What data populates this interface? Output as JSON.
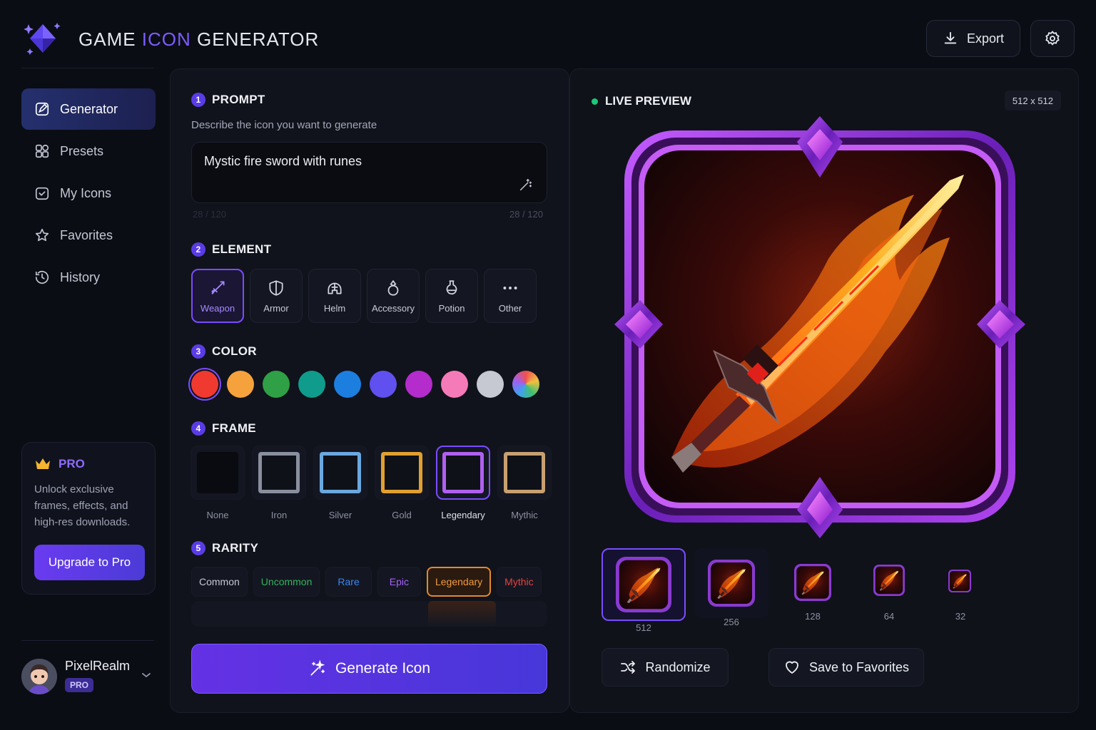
{
  "app": {
    "title_pre": "GAME ",
    "title_accent": "ICON",
    "title_post": " GENERATOR"
  },
  "header": {
    "export_label": "Export",
    "export_icon": "download-icon",
    "settings_icon": "gear-icon"
  },
  "sidebar": {
    "items": [
      {
        "label": "Generator",
        "icon": "edit-square-icon",
        "active": true
      },
      {
        "label": "Presets",
        "icon": "grid-shapes-icon",
        "active": false
      },
      {
        "label": "My Icons",
        "icon": "folder-check-icon",
        "active": false
      },
      {
        "label": "Favorites",
        "icon": "star-icon",
        "active": false
      },
      {
        "label": "History",
        "icon": "history-icon",
        "active": false
      }
    ],
    "pro": {
      "title": "PRO",
      "text": "Unlock exclusive frames, effects, and high-res downloads.",
      "button": "Upgrade to Pro"
    },
    "user": {
      "name": "PixelRealm",
      "badge": "PRO"
    }
  },
  "prompt": {
    "num": "1",
    "title": "PROMPT",
    "hint": "Describe the icon you want to generate",
    "value": "Mystic fire sword with runes",
    "count_left": "28 / 120",
    "count_right": "28 / 120"
  },
  "element": {
    "num": "2",
    "title": "ELEMENT",
    "items": [
      {
        "label": "Weapon",
        "icon": "sword-icon",
        "active": true
      },
      {
        "label": "Armor",
        "icon": "shield-icon",
        "active": false
      },
      {
        "label": "Helm",
        "icon": "helmet-icon",
        "active": false
      },
      {
        "label": "Accessory",
        "icon": "ring-icon",
        "active": false
      },
      {
        "label": "Potion",
        "icon": "potion-icon",
        "active": false
      },
      {
        "label": "Other",
        "icon": "more-icon",
        "active": false
      }
    ]
  },
  "color": {
    "num": "3",
    "title": "COLOR",
    "swatches": [
      "#f03a30",
      "#f5a23c",
      "#2fa045",
      "#0f9c8c",
      "#1c7fe0",
      "#6050f0",
      "#b42ccc",
      "#f57ab8",
      "#c6c9d2",
      "rainbow"
    ],
    "selected": 0
  },
  "frame": {
    "num": "4",
    "title": "FRAME",
    "items": [
      {
        "label": "None",
        "color": "#0a0b10",
        "active": false
      },
      {
        "label": "Iron",
        "color": "#8a8f9e",
        "active": false
      },
      {
        "label": "Silver",
        "color": "#6aa8e0",
        "active": false
      },
      {
        "label": "Gold",
        "color": "#e0a030",
        "active": false
      },
      {
        "label": "Legendary",
        "color": "#b060f0",
        "active": true
      },
      {
        "label": "Mythic",
        "color": "#c8a070",
        "active": false
      }
    ]
  },
  "rarity": {
    "num": "5",
    "title": "RARITY",
    "items": [
      {
        "label": "Common",
        "color": "#c6c8d2",
        "active": false
      },
      {
        "label": "Uncommon",
        "color": "#33b45a",
        "active": false
      },
      {
        "label": "Rare",
        "color": "#3b86f0",
        "active": false
      },
      {
        "label": "Epic",
        "color": "#a560f5",
        "active": false
      },
      {
        "label": "Legendary",
        "color": "#f29a3a",
        "active": true
      },
      {
        "label": "Mythic",
        "color": "#e8413c",
        "active": false
      }
    ]
  },
  "generate": {
    "label": "Generate Icon",
    "icon": "sparkles-icon"
  },
  "preview": {
    "title": "LIVE PREVIEW",
    "size": "512 x 512",
    "sizes": [
      "512",
      "256",
      "128",
      "64",
      "32"
    ],
    "selected_size": "512",
    "randomize_label": "Randomize",
    "favorite_label": "Save to Favorites"
  },
  "colors": {
    "accent": "#7b5cff",
    "bg": "#0b0d14",
    "panel": "#10131b",
    "live_dot": "#1fc77a",
    "legendary": "#e08b2c"
  }
}
